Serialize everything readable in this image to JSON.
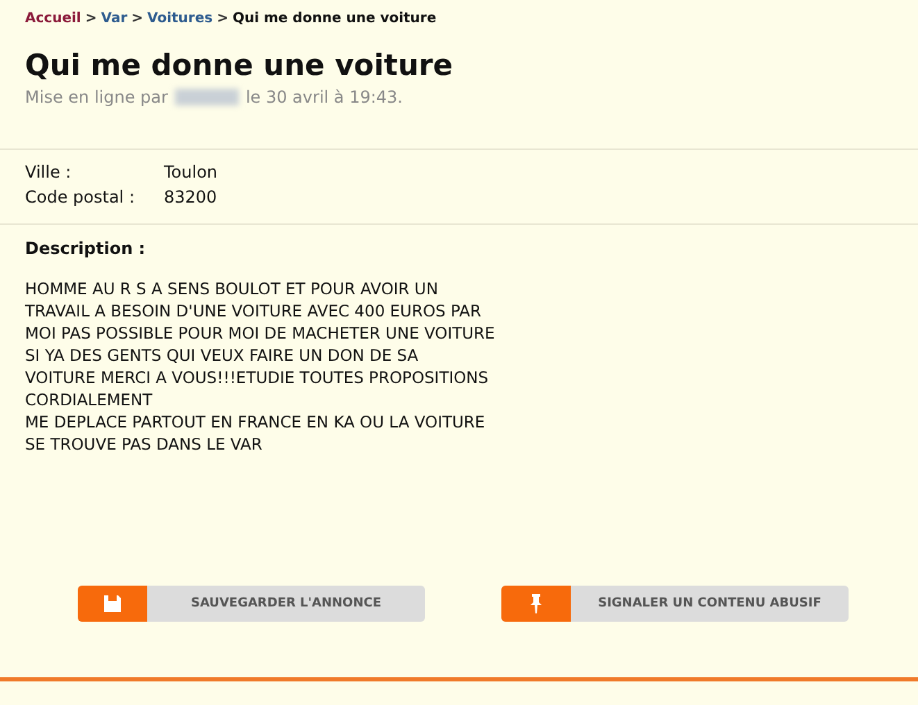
{
  "breadcrumb": [
    {
      "label": "Accueil",
      "kind": "home"
    },
    {
      "label": "Var",
      "kind": "link"
    },
    {
      "label": "Voitures",
      "kind": "link"
    },
    {
      "label": "Qui me donne une voiture",
      "kind": "current"
    }
  ],
  "breadcrumb_separator": ">",
  "title": "Qui me donne une voiture",
  "posted": {
    "prefix": "Mise en ligne par",
    "suffix": "le 30 avril à 19:43."
  },
  "details": [
    {
      "label": "Ville :",
      "value": "Toulon"
    },
    {
      "label": "Code postal :",
      "value": "83200"
    }
  ],
  "description": {
    "heading": "Description :",
    "lines": [
      "HOMME AU R S A SENS BOULOT ET POUR AVOIR UN",
      "TRAVAIL A BESOIN D'UNE VOITURE AVEC 400 EUROS PAR",
      "MOI PAS POSSIBLE POUR MOI DE MACHETER UNE VOITURE",
      "SI YA DES GENTS QUI VEUX FAIRE UN DON DE SA",
      "VOITURE MERCI A VOUS!!!ETUDIE TOUTES PROPOSITIONS",
      "CORDIALEMENT",
      "ME DEPLACE PARTOUT EN FRANCE EN KA OU LA VOITURE",
      "SE TROUVE PAS DANS LE VAR"
    ]
  },
  "buttons": [
    {
      "label": "SAUVEGARDER L'ANNONCE",
      "kind": "save"
    },
    {
      "label": "SIGNALER UN CONTENU ABUSIF",
      "kind": "report"
    }
  ]
}
